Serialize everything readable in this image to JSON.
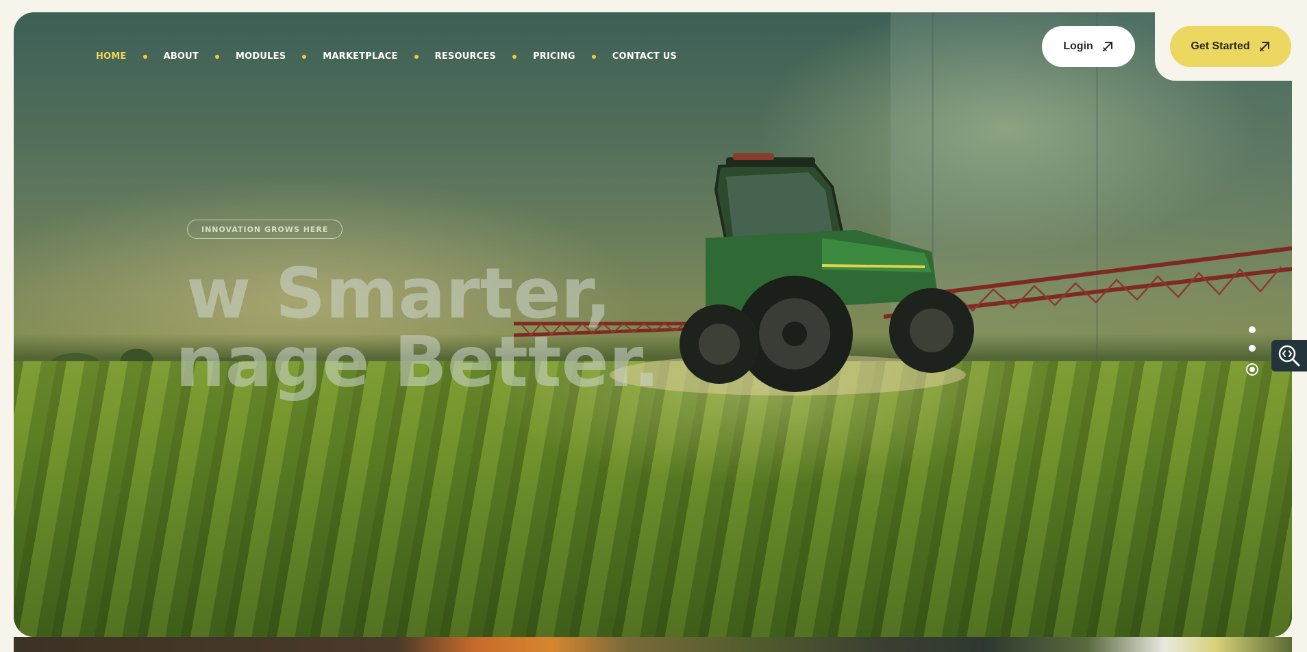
{
  "nav": {
    "items": [
      {
        "label": "HOME",
        "active": true
      },
      {
        "label": "ABOUT",
        "active": false
      },
      {
        "label": "MODULES",
        "active": false
      },
      {
        "label": "MARKETPLACE",
        "active": false
      },
      {
        "label": "RESOURCES",
        "active": false
      },
      {
        "label": "PRICING",
        "active": false
      },
      {
        "label": "CONTACT US",
        "active": false
      }
    ],
    "login_label": "Login",
    "get_started_label": "Get Started"
  },
  "hero": {
    "badge": "INNOVATION GROWS HERE",
    "headline_line1": "w Smarter,",
    "headline_line2": "nage Better."
  },
  "slider": {
    "dots": 3,
    "active_index": 2
  },
  "icons": {
    "arrow": "arrow-up-right-icon",
    "zoom": "zoom-inspect-icon"
  },
  "colors": {
    "background": "#f7f4ec",
    "accent_yellow": "#ecd860",
    "nav_active": "#f2d65a",
    "nav_dot": "#e8cd3c",
    "login_bg": "#ffffff",
    "dark_text": "#1f2d22"
  }
}
